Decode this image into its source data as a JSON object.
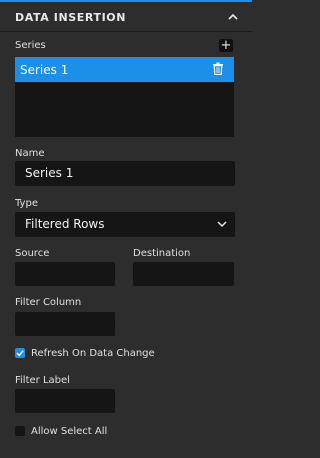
{
  "header": {
    "title": "DATA INSERTION"
  },
  "series": {
    "label": "Series",
    "add_label": "+",
    "items": [
      {
        "label": "Series 1",
        "selected": true
      }
    ]
  },
  "name_field": {
    "label": "Name",
    "value": "Series 1"
  },
  "type_field": {
    "label": "Type",
    "value": "Filtered Rows"
  },
  "source_field": {
    "label": "Source",
    "value": ""
  },
  "destination_field": {
    "label": "Destination",
    "value": ""
  },
  "filter_column_field": {
    "label": "Filter Column",
    "value": ""
  },
  "refresh_checkbox": {
    "label": "Refresh On Data Change",
    "checked": true
  },
  "filter_label_field": {
    "label": "Filter Label",
    "value": ""
  },
  "allow_select_all_checkbox": {
    "label": "Allow Select All",
    "checked": false
  },
  "colors": {
    "accent": "#1c8fe8",
    "panel": "#2d2d2d",
    "field": "#151515"
  }
}
